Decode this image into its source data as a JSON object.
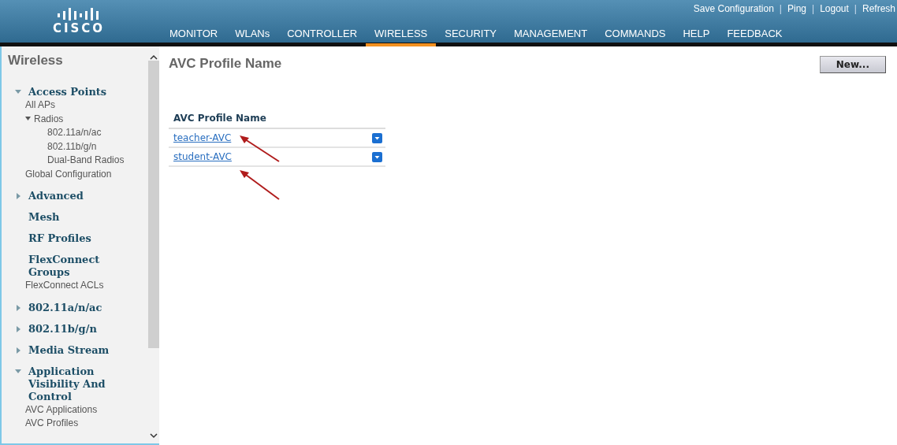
{
  "header": {
    "logo": "CISCO",
    "links": [
      {
        "kind": "link",
        "label": "Save Configuration"
      },
      {
        "kind": "separator",
        "label": "|"
      },
      {
        "kind": "link",
        "label": "Ping"
      },
      {
        "kind": "separator",
        "label": "|"
      },
      {
        "kind": "link",
        "label": "Logout"
      },
      {
        "kind": "separator",
        "label": "|"
      },
      {
        "kind": "link",
        "label": "Refresh"
      }
    ],
    "menu": [
      {
        "label": "MONITOR",
        "selected": false
      },
      {
        "label": "WLANs",
        "selected": false
      },
      {
        "label": "CONTROLLER",
        "selected": false
      },
      {
        "label": "WIRELESS",
        "selected": true
      },
      {
        "label": "SECURITY",
        "selected": false
      },
      {
        "label": "MANAGEMENT",
        "selected": false
      },
      {
        "label": "COMMANDS",
        "selected": false
      },
      {
        "label": "HELP",
        "selected": false
      },
      {
        "label": "FEEDBACK",
        "selected": false
      }
    ]
  },
  "sidebar": {
    "title": "Wireless",
    "items": [
      {
        "label": "Access Points",
        "expanded": true,
        "children": [
          {
            "label": "All APs"
          },
          {
            "label": "Radios",
            "expanded": true,
            "children": [
              {
                "label": "802.11a/n/ac"
              },
              {
                "label": "802.11b/g/n"
              },
              {
                "label": "Dual-Band Radios"
              }
            ]
          },
          {
            "label": "Global Configuration"
          }
        ]
      },
      {
        "label": "Advanced",
        "expanded": false
      },
      {
        "label": "Mesh"
      },
      {
        "label": "RF Profiles"
      },
      {
        "label": "FlexConnect Groups",
        "children": [
          {
            "label": "FlexConnect ACLs"
          }
        ]
      },
      {
        "label": "802.11a/n/ac",
        "expanded": false
      },
      {
        "label": "802.11b/g/n",
        "expanded": false
      },
      {
        "label": "Media Stream",
        "expanded": false
      },
      {
        "label": "Application Visibility And Control",
        "expanded": true,
        "children": [
          {
            "label": "AVC Applications"
          },
          {
            "label": "AVC Profiles"
          }
        ]
      }
    ]
  },
  "main": {
    "title": "AVC Profile Name",
    "new_button": "New...",
    "table": {
      "columns": [
        "AVC Profile Name"
      ],
      "rows": [
        {
          "name": "teacher-AVC"
        },
        {
          "name": "student-AVC"
        }
      ]
    }
  }
}
